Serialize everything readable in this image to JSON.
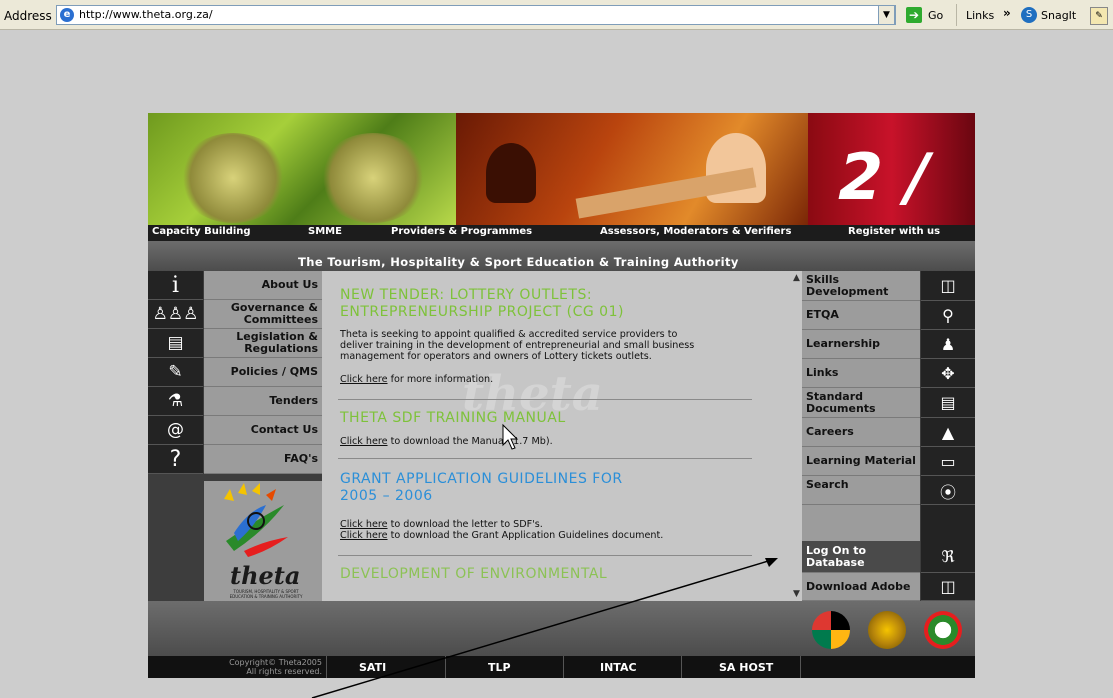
{
  "browser": {
    "address_label": "Address",
    "url": "http://www.theta.org.za/",
    "go_label": "Go",
    "links_label": "Links",
    "chevron": "»",
    "snagit_label": "SnagIt"
  },
  "banner": {
    "topnav": [
      "Capacity Building",
      "SMME",
      "Providers & Programmes",
      "Assessors, Moderators & Verifiers",
      "Register with us"
    ],
    "subtitle": "The Tourism, Hospitality & Sport Education & Training Authority"
  },
  "left_nav": {
    "items": [
      {
        "label": "About Us",
        "icon": "info-icon",
        "glyph": "i"
      },
      {
        "label": "Governance & Committees",
        "icon": "people-icon",
        "glyph": "👥"
      },
      {
        "label": "Legislation & Regulations",
        "icon": "document-icon",
        "glyph": "🗎"
      },
      {
        "label": "Policies / QMS",
        "icon": "policy-icon",
        "glyph": "🗒"
      },
      {
        "label": "Tenders",
        "icon": "tender-icon",
        "glyph": "⚙"
      },
      {
        "label": "Contact Us",
        "icon": "at-icon",
        "glyph": "@"
      },
      {
        "label": "FAQ's",
        "icon": "question-icon",
        "glyph": "?"
      }
    ],
    "logo_text": "theta",
    "logo_sub": "TOURISM, HOSPITALITY & SPORT EDUCATION & TRAINING AUTHORITY"
  },
  "content": {
    "articles": [
      {
        "title_line1": "NEW TENDER: LOTTERY OUTLETS:",
        "title_line2": "ENTREPRENEURSHIP PROJECT (CG 01)",
        "body_line1": "Theta is seeking to appoint qualified & accredited service providers to",
        "body_line2": "deliver training in the development of entrepreneurial and small business",
        "body_line3": "management for operators and owners of Lottery tickets outlets.",
        "link": "Click here",
        "link_suffix": " for more information."
      },
      {
        "title_line1": "THETA SDF TRAINING MANUAL",
        "link": "Click here",
        "link_suffix": " to download the Manual (1.7 Mb)."
      },
      {
        "title_line1": "GRANT APPLICATION GUIDELINES FOR",
        "title_line2": "2005 – 2006",
        "link1": "Click here",
        "link1_suffix": " to download the letter to SDF's.",
        "link2": "Click here",
        "link2_suffix": " to download the Grant Application Guidelines document."
      },
      {
        "title_line1": "DEVELOPMENT OF ENVIRONMENTAL"
      }
    ],
    "watermark": "theta"
  },
  "right_nav": {
    "items": [
      {
        "label": "Skills Development",
        "icon": "book-icon",
        "glyph": "📖"
      },
      {
        "label": "ETQA",
        "icon": "award-icon",
        "glyph": "🎗"
      },
      {
        "label": "Learnership",
        "icon": "learner-icon",
        "glyph": "♟"
      },
      {
        "label": "Links",
        "icon": "move-icon",
        "glyph": "✥"
      },
      {
        "label": "Standard Documents",
        "icon": "document-icon",
        "glyph": "🗎"
      },
      {
        "label": "Careers",
        "icon": "megaphone-icon",
        "glyph": "📢"
      },
      {
        "label": "Learning Material",
        "icon": "monitor-icon",
        "glyph": "🖵"
      },
      {
        "label": "Search",
        "icon": "search-icon",
        "glyph": "⊛"
      },
      {
        "label": "",
        "icon": "",
        "glyph": ""
      },
      {
        "label": "Log On to Database",
        "icon": "people-icon",
        "glyph": "ℜ"
      },
      {
        "label": "Download Adobe",
        "icon": "book-icon",
        "glyph": "📖"
      }
    ]
  },
  "footer": {
    "copyright_line1": "Copyright© Theta2005",
    "copyright_line2": "All rights reserved.",
    "links": [
      "SATI",
      "TLP",
      "INTAC",
      "SA HOST"
    ]
  },
  "colors": {
    "green_heading": "#7ec23a",
    "blue_heading": "#2b8fd8",
    "page_bg": "#cdcdcd"
  }
}
